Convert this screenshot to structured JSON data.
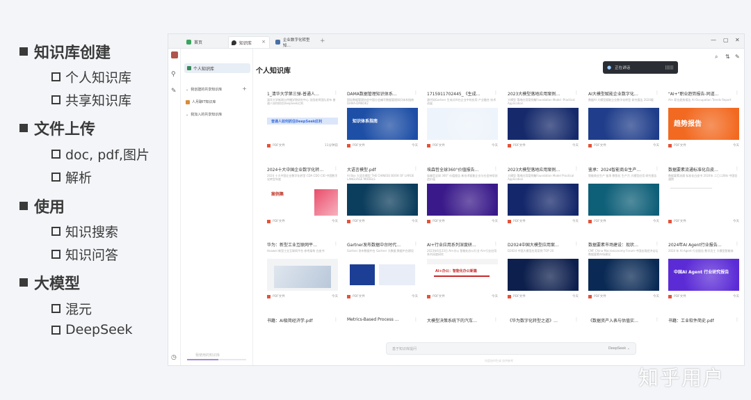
{
  "outline": {
    "items": [
      {
        "level": 1,
        "text": "知识库创建"
      },
      {
        "level": 2,
        "text": "个人知识库"
      },
      {
        "level": 2,
        "text": "共享知识库"
      },
      {
        "level": 1,
        "text": "文件上传"
      },
      {
        "level": 2,
        "text": "doc, pdf,图片"
      },
      {
        "level": 2,
        "text": "解析"
      },
      {
        "level": 1,
        "text": "使用"
      },
      {
        "level": 2,
        "text": "知识搜索"
      },
      {
        "level": 2,
        "text": "知识问答"
      },
      {
        "level": 1,
        "text": "大模型"
      },
      {
        "level": 2,
        "text": "混元"
      },
      {
        "level": 2,
        "text": "DeepSeek"
      }
    ]
  },
  "app": {
    "tabs": [
      {
        "label": "首页",
        "icon": "home-icon",
        "active": false
      },
      {
        "label": "知识库",
        "icon": "location-pin-icon",
        "active": true
      },
      {
        "label": "企业数字化转型知…",
        "icon": "document-icon",
        "active": false
      }
    ],
    "sidebar": {
      "selected": "个人知识库",
      "rows": [
        {
          "label": "我创建的共享知识库",
          "icon": "chevron-down-icon"
        },
        {
          "label": "人月聊IT知识库",
          "icon": "avatar-icon"
        },
        {
          "label": "我加入的共享知识库",
          "icon": "chevron-down-icon"
        }
      ],
      "footer": "我使用的知识库"
    },
    "main": {
      "title": "个人知识库",
      "voice_text": "正在讲话"
    },
    "cards": [
      {
        "title": "1_清华大学第三弹-普通人…",
        "desc": "清华大学新闻与传播学院研究中心 沈阳老师团队发布 普通人如何抓住DeepSeek红利",
        "tag": "PDF文件",
        "date": "11分钟前",
        "thumb": {
          "kind": "doc",
          "bg": "#ffffff",
          "band": "#dbe6fb",
          "text": "普通人如何抓住DeepSeek红利",
          "tc": "#3b6fd8"
        }
      },
      {
        "title": "DAMA数据管理知识体系…",
        "desc": "国际数据管理协会中国分会编写数据管理知识体系指南DAMA-DMBOK2",
        "tag": "PDF文件",
        "date": "今天",
        "thumb": {
          "kind": "blue",
          "bg": "#1e4fa6",
          "text": "知识体系指南",
          "tc": "#ffffff"
        }
      },
      {
        "title": "1715911702445_《生成…",
        "desc": "源代码Gartner 生成式AI在企业中的应用 产业融合 技术进展",
        "tag": "PDF文件",
        "date": "今天",
        "thumb": {
          "kind": "lightblue",
          "bg": "#eef4fb",
          "text": "",
          "tc": "#3a7bd5"
        }
      },
      {
        "title": "2023大模型落地应用案例…",
        "desc": "大模型 落地应用案例集Foundation Model -Practical Application",
        "tag": "PDF文件",
        "date": "今天",
        "thumb": {
          "kind": "navy",
          "bg": "#162a6b",
          "text": "",
          "tc": "#ffffff"
        }
      },
      {
        "title": "AI大模型赋能企业数字化…",
        "desc": "数据AI 大模型赋能企业数字化转型 研究报告 2024版",
        "tag": "PDF文件",
        "date": "今天",
        "thumb": {
          "kind": "navy",
          "bg": "#1f3d8a",
          "text": "",
          "tc": "#ffffff"
        }
      },
      {
        "title": "\"AI+\"职业趋势报告-同道…",
        "desc": "AI+ 职业趋势报告 AI Occupation Trends Report",
        "tag": "PDF文件",
        "date": "今天",
        "thumb": {
          "kind": "orange",
          "bg": "#f26a21",
          "text": "趋势报告",
          "tc": "#ffffff"
        }
      },
      {
        "title": "2024十大中国企业数字化转…",
        "desc": "2024 十大中国企业数字化转型 CDA CDO CIO 中国数字化转型年度",
        "tag": "PDF文件",
        "date": "今天",
        "thumb": {
          "kind": "doc2",
          "bg": "#ffffff",
          "band": "#f0d9df",
          "text": "案例集",
          "tc": "#c0392b"
        }
      },
      {
        "title": "大语言模型.pdf",
        "desc": "AI Box 大语言模型 THE CHINESE BOOK OF LARGE LANGUAGE MODELS",
        "tag": "PDF文件",
        "date": "今天",
        "thumb": {
          "kind": "teal",
          "bg": "#0b3d5c",
          "text": "",
          "tc": "#38d0ff"
        }
      },
      {
        "title": "埃森哲全球360°价值报告…",
        "desc": "埃森哲全球 360° 价值报告 新技术赋能企业与社会持续创造价值",
        "tag": "PDF文件",
        "date": "今天",
        "thumb": {
          "kind": "purple",
          "bg": "#3a1a8a",
          "text": "",
          "tc": "#ffffff"
        }
      },
      {
        "title": "2023大模型落地应用案例…",
        "desc": "大模型 落地应用案例集Foundation Model Practical Application",
        "tag": "PDF文件",
        "date": "今天",
        "thumb": {
          "kind": "navy",
          "bg": "#14276a",
          "text": "",
          "tc": "#ffffff"
        }
      },
      {
        "title": "鉴承：2024智能商业生产…",
        "desc": "智能商业生产 鉴承 数智化 生产力 大模型应用 研究报告",
        "tag": "PDF文件",
        "date": "今天",
        "thumb": {
          "kind": "cyan",
          "bg": "#0e5f78",
          "text": "",
          "tc": "#ffffff"
        }
      },
      {
        "title": "数据要素流通标准化白皮…",
        "desc": "数据要素流通 标准化白皮书 2024年 二〇二四年 中国信通院",
        "tag": "PDF文件",
        "date": "今天",
        "thumb": {
          "kind": "blank",
          "bg": "#ffffff",
          "text": "",
          "tc": "#999999"
        }
      },
      {
        "title": "华为：新型工业互联网平…",
        "desc": "Huawei 新型工业互联网平台 参考架构 白皮书",
        "tag": "PDF文件",
        "date": "今天",
        "thumb": {
          "kind": "grey",
          "bg": "#f2f3f5",
          "text": "",
          "tc": "#333333"
        }
      },
      {
        "title": "Gartner发布数据中台时代…",
        "desc": "Gartner 发布数据中台 Gartner 大数据 数据中台建设",
        "tag": "PDF文件",
        "date": "今天",
        "thumb": {
          "kind": "gartner",
          "bg": "#ffffff",
          "text": "",
          "tc": "#1c3f95"
        }
      },
      {
        "title": "AI+行业应用系列深度研…",
        "desc": "2023年6月23日 AI+办公 智能化办公行业 AI+行业应用系列深度研究",
        "tag": "PDF文件",
        "date": "今天",
        "thumb": {
          "kind": "redtxt",
          "bg": "#ffffff",
          "text": "AI+办公：智能化办公新篇",
          "tc": "#c62828"
        }
      },
      {
        "title": "D2024中国大模型应用案…",
        "desc": "D2024 中国大模型应用案例 TOP 20",
        "tag": "PDF文件",
        "date": "今天",
        "thumb": {
          "kind": "darkblue",
          "bg": "#0d1f4d",
          "text": "",
          "tc": "#ffffff"
        }
      },
      {
        "title": "数据要素市场建设：现状…",
        "desc": "CMF China Macroeconomy Forum 中国宏观经济论坛 数据要素市场建设",
        "tag": "PDF文件",
        "date": "今天",
        "thumb": {
          "kind": "deep",
          "bg": "#0a2a55",
          "text": "",
          "tc": "#ffffff"
        }
      },
      {
        "title": "2024年AI Agent行业报告…",
        "desc": "2024 年 AI Agent 行业报告 数字员工 大模型智能体",
        "tag": "PDF文件",
        "date": "今天",
        "thumb": {
          "kind": "violet",
          "bg": "#5b2bd6",
          "text": "中国AI Agent 行业研究报告",
          "tc": "#ffffff"
        }
      },
      {
        "title": "书籍：AI极简经济学.pdf",
        "desc": "",
        "tag": "",
        "date": "",
        "thumb": {
          "kind": "none",
          "bg": "#ffffff",
          "text": "",
          "tc": "#333333"
        }
      },
      {
        "title": "Metrics-Based Process …",
        "desc": "",
        "tag": "",
        "date": "",
        "thumb": {
          "kind": "none",
          "bg": "#ffffff",
          "text": "",
          "tc": "#333333"
        }
      },
      {
        "title": "大模型决策系统下的汽车…",
        "desc": "",
        "tag": "",
        "date": "",
        "thumb": {
          "kind": "none",
          "bg": "#ffffff",
          "text": "",
          "tc": "#333333"
        }
      },
      {
        "title": "《华为数字化转型之道》…",
        "desc": "",
        "tag": "",
        "date": "",
        "thumb": {
          "kind": "none",
          "bg": "#ffffff",
          "text": "",
          "tc": "#333333"
        }
      },
      {
        "title": "《数据资产入表与估值实…",
        "desc": "",
        "tag": "",
        "date": "",
        "thumb": {
          "kind": "none",
          "bg": "#ffffff",
          "text": "",
          "tc": "#333333"
        }
      },
      {
        "title": "书籍：工业软件简史.pdf",
        "desc": "",
        "tag": "",
        "date": "",
        "thumb": {
          "kind": "none",
          "bg": "#ffffff",
          "text": "",
          "tc": "#333333"
        }
      }
    ],
    "chat": {
      "placeholder": "基于知识库提问",
      "model": "DeepSeek ⌄",
      "hint": "内容由AI生成 仅供参考"
    }
  },
  "watermark": "知乎用户"
}
